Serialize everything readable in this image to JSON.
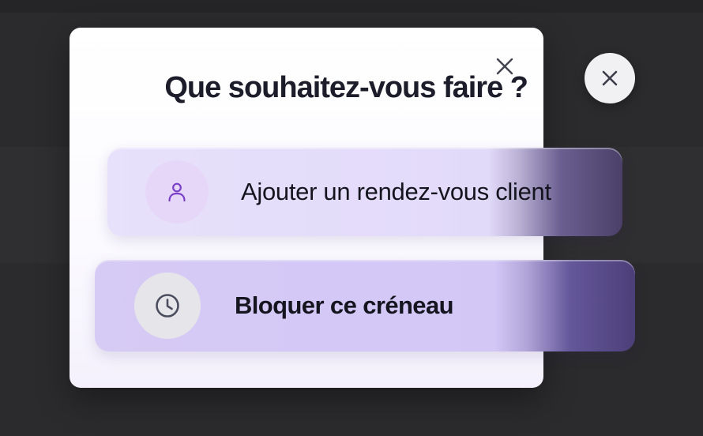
{
  "modal": {
    "title": "Que souhaitez-vous faire ?",
    "close_icon": "close-icon"
  },
  "outer_close": {
    "icon": "close-icon"
  },
  "options": [
    {
      "label": "Ajouter un rendez-vous client",
      "icon": "user-icon",
      "icon_color": "#7a3fc8"
    },
    {
      "label": "Bloquer ce créneau",
      "icon": "clock-icon",
      "icon_color": "#4a4e5e"
    }
  ],
  "colors": {
    "backdrop": "#2b2b2d",
    "modal_bg": "#ffffff",
    "option_1_bg": "#e4ddfa",
    "option_2_bg": "#d4c9f6",
    "accent": "#7a3fc8"
  }
}
